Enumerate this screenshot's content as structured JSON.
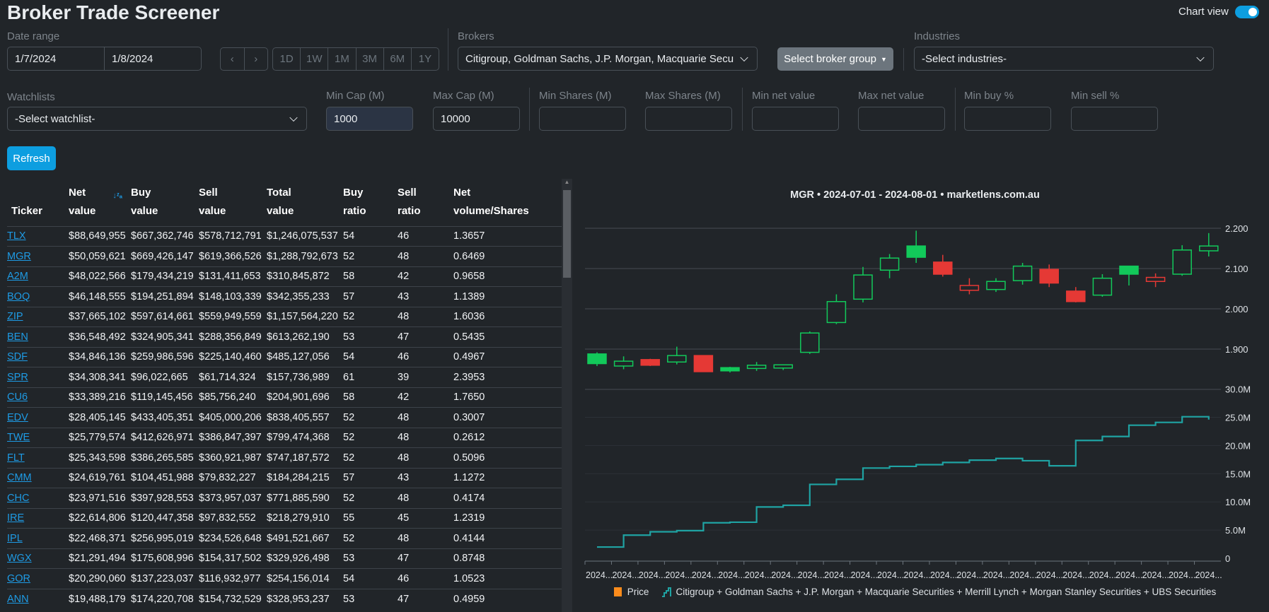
{
  "header": {
    "title": "Broker Trade Screener",
    "chart_view_label": "Chart view",
    "chart_view_on": true
  },
  "filters": {
    "date_range_label": "Date range",
    "date_from": "1/7/2024",
    "date_to": "1/8/2024",
    "prev_icon": "chevron-left-icon",
    "next_icon": "chevron-right-icon",
    "periods": [
      "1D",
      "1W",
      "1M",
      "3M",
      "6M",
      "1Y"
    ],
    "brokers_label": "Brokers",
    "brokers_value": "Citigroup, Goldman Sachs, J.P. Morgan, Macquarie Secu",
    "broker_group_button": "Select broker group",
    "industries_label": "Industries",
    "industries_value": "-Select industries-",
    "watchlists_label": "Watchlists",
    "watchlists_value": "-Select watchlist-",
    "min_cap_label": "Min Cap (M)",
    "min_cap": "1000",
    "max_cap_label": "Max Cap (M)",
    "max_cap": "10000",
    "min_shares_label": "Min Shares (M)",
    "min_shares": "",
    "max_shares_label": "Max Shares (M)",
    "max_shares": "",
    "min_net_label": "Min net value",
    "min_net": "",
    "max_net_label": "Max net value",
    "max_net": "",
    "min_buy_label": "Min buy %",
    "min_buy": "",
    "min_sell_label": "Min sell %",
    "min_sell": "",
    "refresh": "Refresh"
  },
  "table": {
    "columns": [
      [
        "",
        "Ticker"
      ],
      [
        "Net",
        "value"
      ],
      [
        "Buy",
        "value"
      ],
      [
        "Sell",
        "value"
      ],
      [
        "Total",
        "value"
      ],
      [
        "Buy",
        "ratio"
      ],
      [
        "Sell",
        "ratio"
      ],
      [
        "Net",
        "volume/Shares"
      ]
    ],
    "sorted_column": "Net value",
    "sort_direction": "desc",
    "rows": [
      [
        "TLX",
        "$88,649,955",
        "$667,362,746",
        "$578,712,791",
        "$1,246,075,537",
        "54",
        "46",
        "1.3657"
      ],
      [
        "MGR",
        "$50,059,621",
        "$669,426,147",
        "$619,366,526",
        "$1,288,792,673",
        "52",
        "48",
        "0.6469"
      ],
      [
        "A2M",
        "$48,022,566",
        "$179,434,219",
        "$131,411,653",
        "$310,845,872",
        "58",
        "42",
        "0.9658"
      ],
      [
        "BOQ",
        "$46,148,555",
        "$194,251,894",
        "$148,103,339",
        "$342,355,233",
        "57",
        "43",
        "1.1389"
      ],
      [
        "ZIP",
        "$37,665,102",
        "$597,614,661",
        "$559,949,559",
        "$1,157,564,220",
        "52",
        "48",
        "1.6036"
      ],
      [
        "BEN",
        "$36,548,492",
        "$324,905,341",
        "$288,356,849",
        "$613,262,190",
        "53",
        "47",
        "0.5435"
      ],
      [
        "SDF",
        "$34,846,136",
        "$259,986,596",
        "$225,140,460",
        "$485,127,056",
        "54",
        "46",
        "0.4967"
      ],
      [
        "SPR",
        "$34,308,341",
        "$96,022,665",
        "$61,714,324",
        "$157,736,989",
        "61",
        "39",
        "2.3953"
      ],
      [
        "CU6",
        "$33,389,216",
        "$119,145,456",
        "$85,756,240",
        "$204,901,696",
        "58",
        "42",
        "1.7650"
      ],
      [
        "EDV",
        "$28,405,145",
        "$433,405,351",
        "$405,000,206",
        "$838,405,557",
        "52",
        "48",
        "0.3007"
      ],
      [
        "TWE",
        "$25,779,574",
        "$412,626,971",
        "$386,847,397",
        "$799,474,368",
        "52",
        "48",
        "0.2612"
      ],
      [
        "FLT",
        "$25,343,598",
        "$386,265,585",
        "$360,921,987",
        "$747,187,572",
        "52",
        "48",
        "0.5096"
      ],
      [
        "CMM",
        "$24,619,761",
        "$104,451,988",
        "$79,832,227",
        "$184,284,215",
        "57",
        "43",
        "1.1272"
      ],
      [
        "CHC",
        "$23,971,516",
        "$397,928,553",
        "$373,957,037",
        "$771,885,590",
        "52",
        "48",
        "0.4174"
      ],
      [
        "IRE",
        "$22,614,806",
        "$120,447,358",
        "$97,832,552",
        "$218,279,910",
        "55",
        "45",
        "1.2319"
      ],
      [
        "IPL",
        "$22,468,371",
        "$256,995,019",
        "$234,526,648",
        "$491,521,667",
        "52",
        "48",
        "0.4144"
      ],
      [
        "WGX",
        "$21,291,494",
        "$175,608,996",
        "$154,317,502",
        "$329,926,498",
        "53",
        "47",
        "0.8748"
      ],
      [
        "GOR",
        "$20,290,060",
        "$137,223,037",
        "$116,932,977",
        "$254,156,014",
        "54",
        "46",
        "1.0523"
      ],
      [
        "ANN",
        "$19,488,179",
        "$174,220,708",
        "$154,732,529",
        "$328,953,237",
        "53",
        "47",
        "0.4959"
      ]
    ]
  },
  "chart_data": {
    "type": "candlestick+step-line",
    "title": "MGR • 2024-07-01 - 2024-08-01 • marketlens.com.au",
    "x_labels": [
      "2024...",
      "2024...",
      "2024...",
      "2024...",
      "2024...",
      "2024...",
      "2024...",
      "2024...",
      "2024...",
      "2024...",
      "2024...",
      "2024...",
      "2024...",
      "2024...",
      "2024...",
      "2024...",
      "2024...",
      "2024...",
      "2024...",
      "2024...",
      "2024...",
      "2024...",
      "2024...",
      "2024..."
    ],
    "price_axis": {
      "ticks": [
        "1.900",
        "2.000",
        "2.100",
        "2.200"
      ],
      "range": [
        1.8,
        2.25
      ]
    },
    "volume_axis": {
      "ticks": [
        "0",
        "5.0M",
        "10.0M",
        "15.0M",
        "20.0M",
        "25.0M",
        "30.0M"
      ],
      "range": [
        0,
        30
      ]
    },
    "grid": true,
    "colors": {
      "up": "#12c95a",
      "down": "#e53935",
      "volume": "#1fa3a3",
      "price_legend": "#fb8c1c"
    },
    "legend": [
      {
        "name": "Price",
        "icon": "square"
      },
      {
        "name": "Citigroup + Goldman Sachs + J.P. Morgan + Macquarie Securities + Merrill Lynch + Morgan Stanley Securities + UBS Securities",
        "icon": "step-line"
      }
    ],
    "legend_position": "bottom",
    "candles": [
      [
        1.888,
        1.892,
        1.858,
        1.864
      ],
      [
        1.858,
        1.882,
        1.85,
        1.87
      ],
      [
        1.874,
        1.876,
        1.858,
        1.86
      ],
      [
        1.868,
        1.906,
        1.862,
        1.884
      ],
      [
        1.884,
        1.884,
        1.844,
        1.844
      ],
      [
        1.854,
        1.856,
        1.842,
        1.846
      ],
      [
        1.852,
        1.868,
        1.846,
        1.86
      ],
      [
        1.853,
        1.862,
        1.848,
        1.861
      ],
      [
        1.892,
        1.944,
        1.888,
        1.94
      ],
      [
        1.966,
        2.036,
        1.962,
        2.018
      ],
      [
        2.024,
        2.104,
        2.016,
        2.084
      ],
      [
        2.096,
        2.136,
        2.076,
        2.126
      ],
      [
        2.156,
        2.194,
        2.114,
        2.128
      ],
      [
        2.116,
        2.134,
        2.08,
        2.086
      ],
      [
        2.046,
        2.076,
        2.036,
        2.058
      ],
      [
        2.048,
        2.076,
        2.042,
        2.068
      ],
      [
        2.07,
        2.114,
        2.06,
        2.106
      ],
      [
        2.098,
        2.11,
        2.054,
        2.064
      ],
      [
        2.044,
        2.054,
        2.016,
        2.018
      ],
      [
        2.034,
        2.086,
        2.03,
        2.076
      ],
      [
        2.106,
        2.106,
        2.058,
        2.086
      ],
      [
        2.068,
        2.088,
        2.054,
        2.078
      ],
      [
        2.086,
        2.158,
        2.082,
        2.146
      ],
      [
        2.144,
        2.188,
        2.13,
        2.156
      ]
    ],
    "candle_fields": [
      "open",
      "high",
      "low",
      "close"
    ],
    "volume_millions": [
      2.0,
      4.1,
      4.7,
      4.9,
      6.3,
      6.4,
      9.1,
      9.4,
      13.1,
      14.0,
      16.0,
      16.3,
      16.6,
      17.0,
      17.4,
      17.7,
      17.3,
      16.4,
      20.9,
      21.6,
      23.6,
      24.1,
      25.1,
      24.6
    ]
  }
}
